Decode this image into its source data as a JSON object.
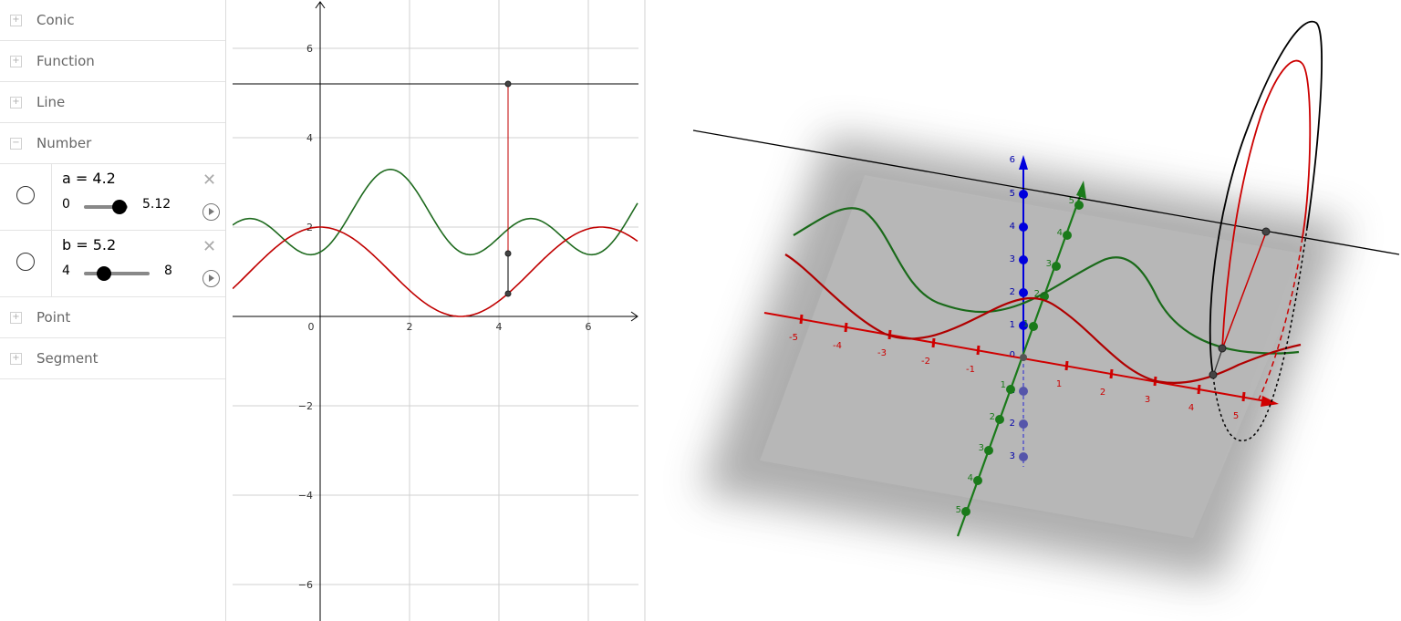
{
  "algebra": {
    "categories": [
      {
        "label": "Conic",
        "expanded": false
      },
      {
        "label": "Function",
        "expanded": false
      },
      {
        "label": "Line",
        "expanded": false
      },
      {
        "label": "Number",
        "expanded": true
      },
      {
        "label": "Point",
        "expanded": false
      },
      {
        "label": "Segment",
        "expanded": false
      }
    ],
    "toggle_plus": "+",
    "toggle_minus": "−",
    "numbers": [
      {
        "definition": "a = 4.2",
        "min": "0",
        "max": "5.12",
        "value": 4.2,
        "min_value": 0,
        "max_value": 5.12
      },
      {
        "definition": "b = 5.2",
        "min": "4",
        "max": "8",
        "value": 5.2,
        "min_value": 4,
        "max_value": 8
      }
    ],
    "delete_glyph": "✕"
  },
  "graphics2d": {
    "x_ticks": [
      "0",
      "2",
      "4",
      "6"
    ],
    "y_ticks": [
      "6",
      "4",
      "2",
      "−2",
      "−4",
      "−6"
    ],
    "colors": {
      "green": "#1e6a1e",
      "red": "#c00000",
      "black": "#000000",
      "grid": "#d0d0d0"
    }
  },
  "graphics3d": {
    "x_ticks": [
      "-5",
      "-4",
      "-3",
      "-2",
      "-1",
      "1",
      "2",
      "3",
      "4",
      "5"
    ],
    "y_ticks": [
      "1",
      "2",
      "3",
      "4",
      "5"
    ],
    "y_ticks_neg": [
      "1",
      "2",
      "3",
      "4",
      "5"
    ],
    "z_ticks": [
      "6",
      "5",
      "4",
      "3",
      "2",
      "1",
      "0"
    ],
    "z_ticks_neg": [
      "1",
      "2",
      "3"
    ],
    "colors": {
      "x_axis": "#d00000",
      "y_axis": "#1a7a1a",
      "z_axis": "#0000dd",
      "plane": "#b8b8b8"
    }
  }
}
